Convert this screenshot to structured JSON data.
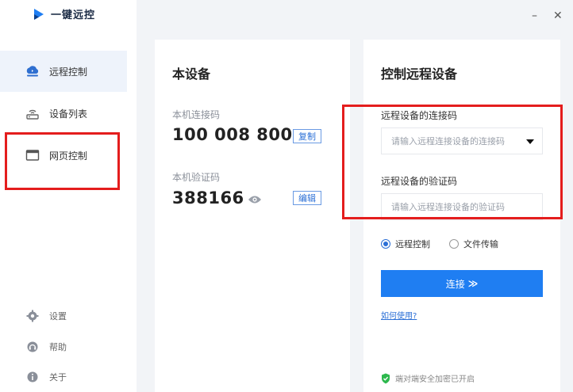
{
  "app": {
    "title": "一键远控"
  },
  "window": {
    "minimize": "–",
    "close": "✕"
  },
  "sidebar": {
    "items": [
      {
        "label": "远程控制",
        "icon": "cloud-remote-icon"
      },
      {
        "label": "设备列表",
        "icon": "router-icon"
      },
      {
        "label": "网页控制",
        "icon": "browser-window-icon"
      }
    ],
    "footer": [
      {
        "label": "设置",
        "icon": "gear-icon"
      },
      {
        "label": "帮助",
        "icon": "headset-icon"
      },
      {
        "label": "关于",
        "icon": "info-icon"
      }
    ]
  },
  "local": {
    "title": "本设备",
    "conn_code_label": "本机连接码",
    "conn_code": "100 008 800",
    "copy_label": "复制",
    "verify_label": "本机验证码",
    "verify_code": "388166",
    "edit_label": "编辑"
  },
  "remote": {
    "title": "控制远程设备",
    "conn_label": "远程设备的连接码",
    "conn_placeholder": "请输入远程连接设备的连接码",
    "verify_label": "远程设备的验证码",
    "verify_placeholder": "请输入远程连接设备的验证码",
    "mode_remote": "远程控制",
    "mode_file": "文件传输",
    "connect_label": "连接",
    "connect_arrow": "≫",
    "help_link": "如何使用?",
    "secure_text": "端对端安全加密已开启"
  },
  "colors": {
    "accent": "#1f7ef2",
    "highlight_box": "#e41d1d"
  }
}
